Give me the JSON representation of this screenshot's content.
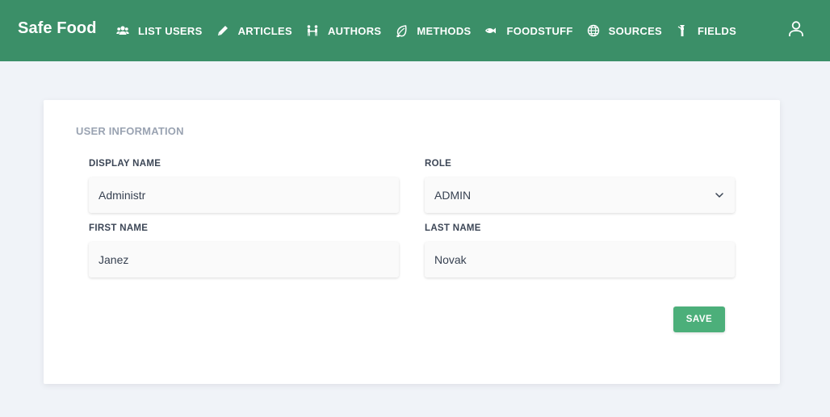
{
  "app": {
    "brand": "Safe Food"
  },
  "nav": {
    "items": [
      {
        "label": "LIST USERS",
        "icon": "users-icon"
      },
      {
        "label": "ARTICLES",
        "icon": "pencil-icon"
      },
      {
        "label": "AUTHORS",
        "icon": "authors-icon"
      },
      {
        "label": "METHODS",
        "icon": "leaf-icon"
      },
      {
        "label": "FOODSTUFF",
        "icon": "fish-icon"
      },
      {
        "label": "SOURCES",
        "icon": "globe-icon"
      },
      {
        "label": "FIELDS",
        "icon": "fields-icon"
      }
    ],
    "user_icon": "user-icon"
  },
  "form": {
    "section_title": "USER INFORMATION",
    "display_name": {
      "label": "DISPLAY NAME",
      "value": "Administr"
    },
    "role": {
      "label": "ROLE",
      "value": "ADMIN"
    },
    "first_name": {
      "label": "FIRST NAME",
      "value": "Janez"
    },
    "last_name": {
      "label": "LAST NAME",
      "value": "Novak"
    },
    "save_label": "SAVE"
  },
  "colors": {
    "navbar": "#3b8f68",
    "background": "#f0f3f8",
    "save_button": "#4caf7a"
  }
}
